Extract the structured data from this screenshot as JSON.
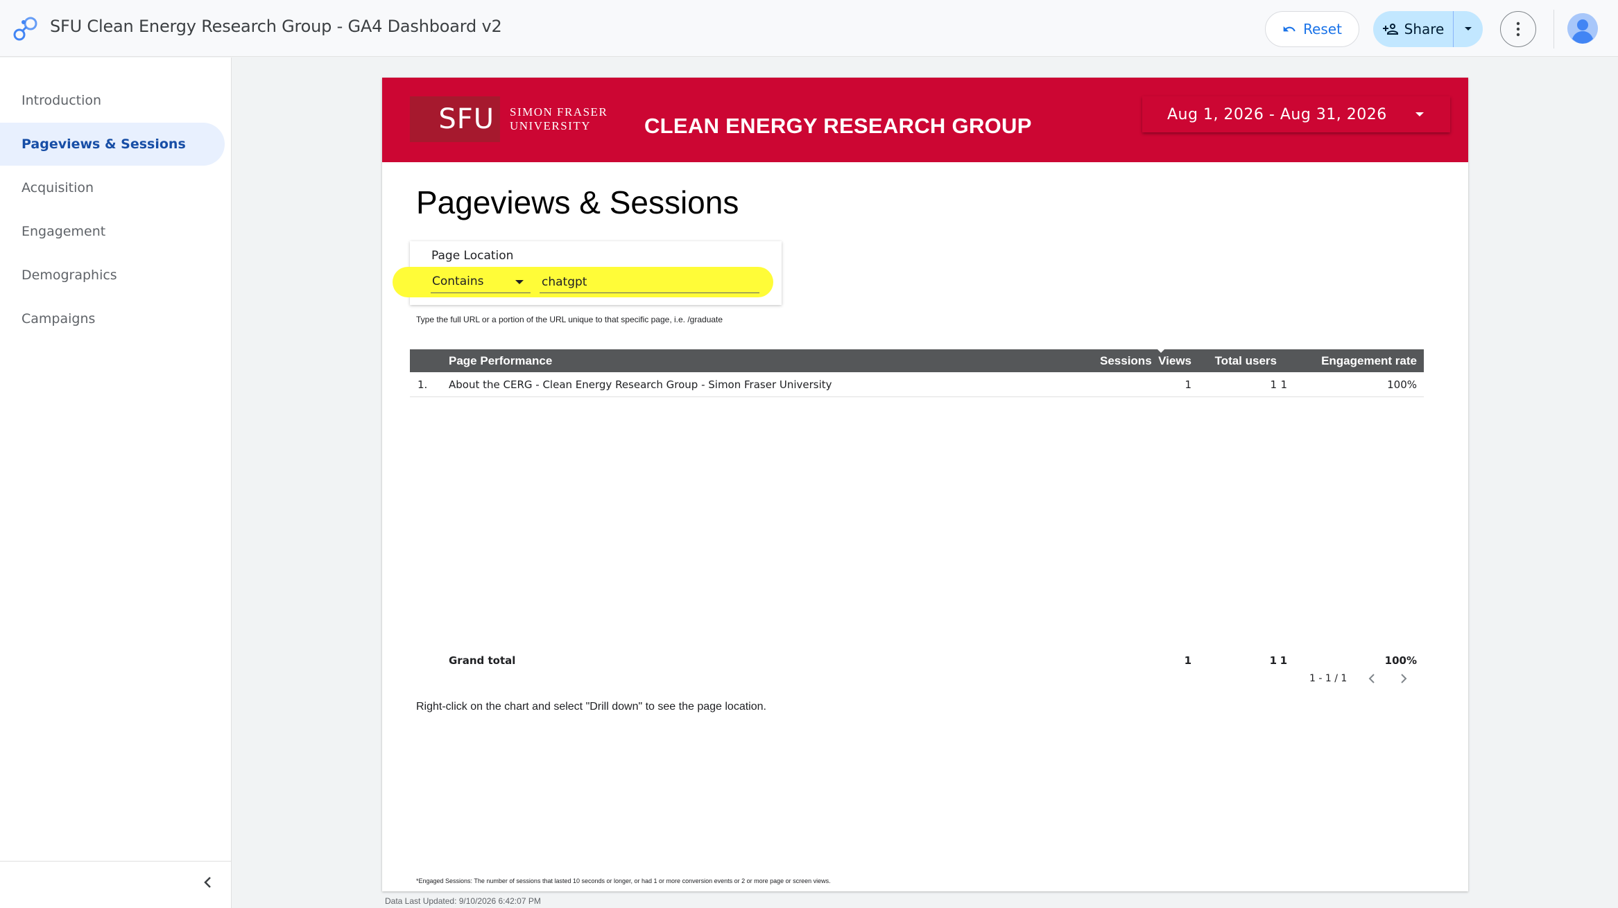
{
  "app": {
    "title": "SFU Clean Energy Research Group - GA4 Dashboard v2",
    "logo_icon": "looker-studio-logo-icon"
  },
  "toolbar": {
    "reset_label": "Reset",
    "share_label": "Share"
  },
  "sidebar": {
    "items": [
      {
        "label": "Introduction",
        "active": false
      },
      {
        "label": "Pageviews & Sessions",
        "active": true
      },
      {
        "label": "Acquisition",
        "active": false
      },
      {
        "label": "Engagement",
        "active": false
      },
      {
        "label": "Demographics",
        "active": false
      },
      {
        "label": "Campaigns",
        "active": false
      }
    ]
  },
  "report": {
    "logo_mark": "SFU",
    "logo_line1": "SIMON FRASER",
    "logo_line2": "UNIVERSITY",
    "group_title": "CLEAN ENERGY RESEARCH GROUP",
    "date_range": "Aug 1, 2026 - Aug 31, 2026",
    "page_title": "Pageviews & Sessions",
    "filter": {
      "label": "Page Location",
      "operator": "Contains",
      "value": "chatgpt",
      "hint": "Type the full URL or a portion of the URL unique to that specific page, i.e. /graduate"
    },
    "table": {
      "columns": [
        "Page Performance",
        "Views",
        "Sessions",
        "Total users",
        "Engagement rate"
      ],
      "rows": [
        {
          "index": "1.",
          "page": "About the CERG - Clean Energy Research Group - Simon Fraser University",
          "views": "1",
          "sessions": "1",
          "users": "1",
          "rate": "100%"
        }
      ],
      "grand_total": {
        "label": "Grand total",
        "views": "1",
        "sessions": "1",
        "users": "1",
        "rate": "100%"
      },
      "pagination": "1 - 1 / 1"
    },
    "drill_note": "Right-click on the chart and select \"Drill down\" to see the page location.",
    "footnote": "*Engaged Sessions: The number of sessions that lasted 10 seconds or longer, or had 1 or more conversion events or 2 or more page or screen views.",
    "updated": "Data Last Updated: 9/10/2026 6:42:07 PM"
  },
  "colors": {
    "sfu_red": "#cc0633",
    "sfu_dark_red": "#a6192e",
    "table_header": "#555759",
    "highlight": "#fffc38",
    "active_nav": "#e8f0fe",
    "share_bg": "#c2e7ff"
  }
}
